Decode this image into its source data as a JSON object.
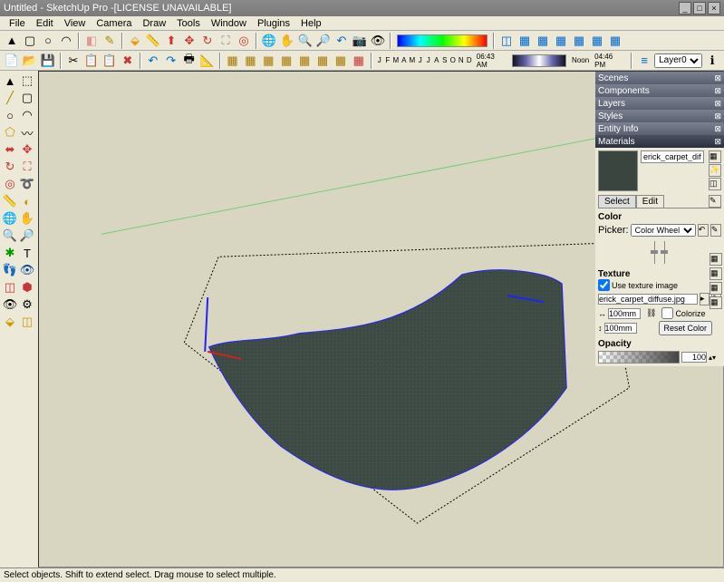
{
  "title": "Untitled - SketchUp Pro -[LICENSE UNAVAILABLE]",
  "menu": [
    "File",
    "Edit",
    "View",
    "Camera",
    "Draw",
    "Tools",
    "Window",
    "Plugins",
    "Help"
  ],
  "months": [
    "J",
    "F",
    "M",
    "A",
    "M",
    "J",
    "J",
    "A",
    "S",
    "O",
    "N",
    "D"
  ],
  "times": {
    "t1": "06:43 AM",
    "t2": "Noon",
    "t3": "04:46 PM"
  },
  "layer_selected": "Layer0",
  "toolbar_icons_top": [
    "pointer",
    "square",
    "circle",
    "arc",
    "eraser",
    "pencil",
    "bucket",
    "tape",
    "push",
    "scale",
    "rotate",
    "move",
    "offset",
    "orbit",
    "pan",
    "zoom",
    "zoomext",
    "prev",
    "camera",
    "section",
    "walk",
    "look",
    "cube1",
    "cube2",
    "cube3",
    "cube4",
    "cube5",
    "cube6",
    "cube7"
  ],
  "toolbar_icons_bottom": [
    "new",
    "open",
    "save",
    "cut",
    "copy",
    "paste",
    "delete",
    "undo",
    "redo",
    "print",
    "model",
    "layer1",
    "layer2",
    "layer3",
    "layer4",
    "layer5",
    "layer6",
    "layer7",
    "layer8"
  ],
  "left_tools": [
    [
      "select",
      "lasso"
    ],
    [
      "line",
      "square"
    ],
    [
      "circle",
      "arc"
    ],
    [
      "poly",
      "free"
    ],
    [
      "eraser",
      "push"
    ],
    [
      "move",
      "rotate"
    ],
    [
      "scale",
      "offset"
    ],
    [
      "tape",
      "protractor"
    ],
    [
      "text",
      "dim"
    ],
    [
      "axes",
      "3dtext"
    ],
    [
      "orbit",
      "pan"
    ],
    [
      "zoom",
      "zoomwin"
    ],
    [
      "zoomext",
      "prev"
    ],
    [
      "pos",
      "look"
    ],
    [
      "walk",
      "section"
    ],
    [
      "sand",
      "smoove"
    ],
    [
      "stamp",
      "drape"
    ],
    [
      "addcon",
      "flip"
    ]
  ],
  "panels": {
    "scenes": "Scenes",
    "components": "Components",
    "layers": "Layers",
    "styles": "Styles",
    "entity_info": "Entity Info",
    "materials": "Materials"
  },
  "materials": {
    "name": "erick_carpet_diffuse",
    "tabs": {
      "select": "Select",
      "edit": "Edit"
    },
    "color_label": "Color",
    "picker_label": "Picker:",
    "picker_value": "Color Wheel",
    "texture_label": "Texture",
    "use_texture": "Use texture image",
    "texture_file": "erick_carpet_diffuse.jpg",
    "width": "100mm",
    "height": "100mm",
    "colorize": "Colorize",
    "reset_color": "Reset Color",
    "opacity_label": "Opacity",
    "opacity_value": "100"
  },
  "status": "Select objects. Shift to extend select. Drag mouse to select multiple."
}
